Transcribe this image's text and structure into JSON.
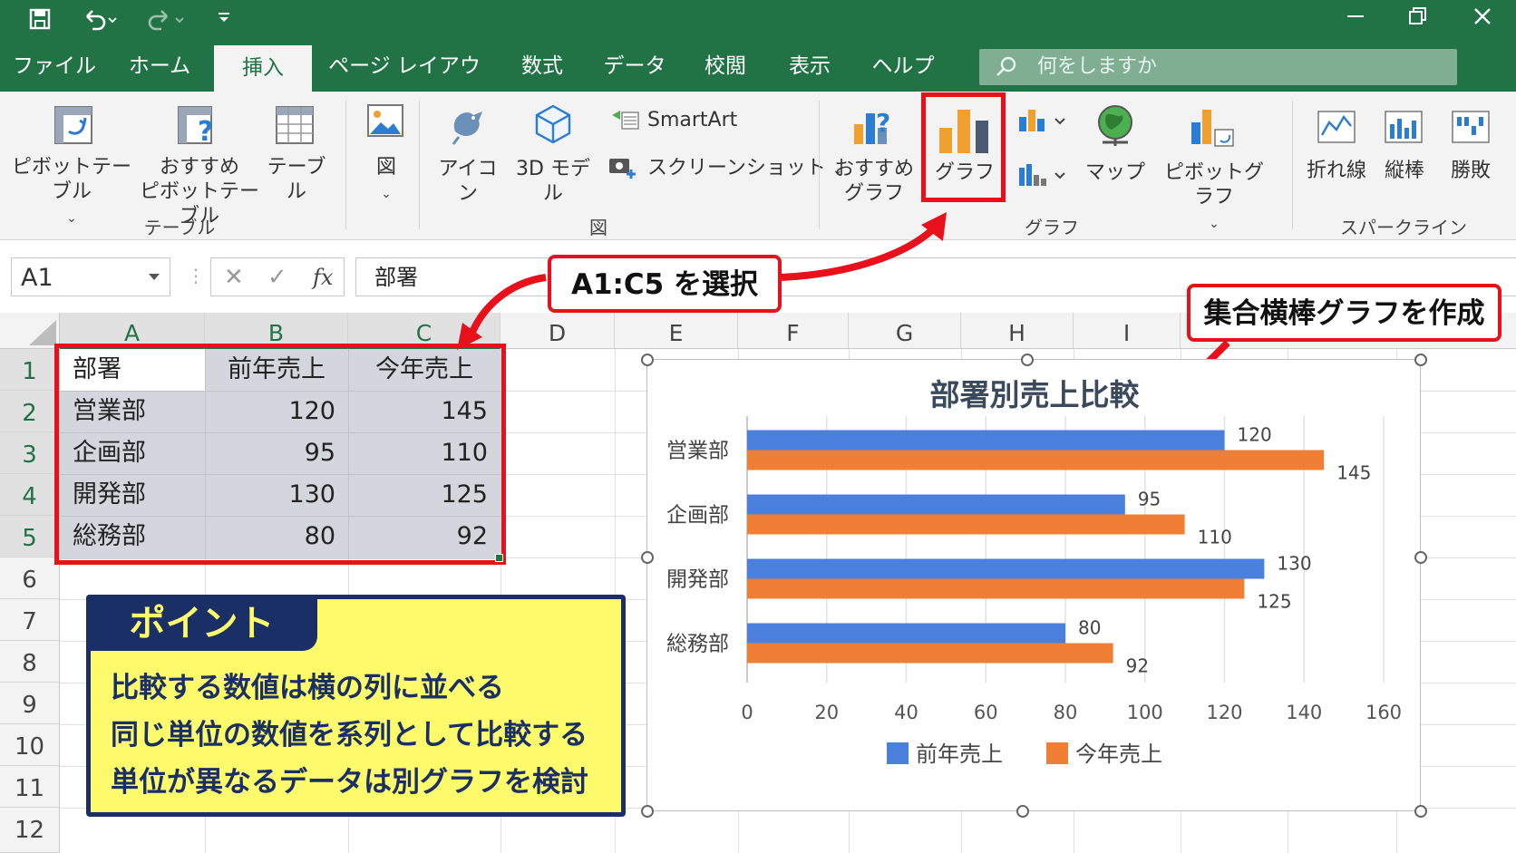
{
  "title_bar": {
    "qat": {
      "save_icon": "save-icon",
      "undo_icon": "undo-icon",
      "redo_icon": "redo-icon"
    }
  },
  "tabs": [
    {
      "label": "ファイル",
      "active": false
    },
    {
      "label": "ホーム",
      "active": false
    },
    {
      "label": "挿入",
      "active": true
    },
    {
      "label": "ページ レイアウト",
      "active": false
    },
    {
      "label": "数式",
      "active": false
    },
    {
      "label": "データ",
      "active": false
    },
    {
      "label": "校閲",
      "active": false
    },
    {
      "label": "表示",
      "active": false
    },
    {
      "label": "ヘルプ",
      "active": false
    }
  ],
  "search": {
    "placeholder": "何をしますか"
  },
  "ribbon": {
    "pivot_table": "ピボットテーブル",
    "recommended_pivot_1": "おすすめ",
    "recommended_pivot_2": "ピボットテーブル",
    "table": "テーブル",
    "group_table": "テーブル",
    "picture": "図",
    "icons": "アイコン",
    "model_3d": "3D モデル",
    "smartart": "SmartArt",
    "screenshot": "スクリーンショット",
    "group_illust": "図",
    "recommended_charts_1": "おすすめ",
    "recommended_charts_2": "グラフ",
    "charts_button": "グラフ",
    "maps": "マップ",
    "pivot_chart": "ピボットグラフ",
    "group_charts": "グラフ",
    "spark_line": "折れ線",
    "spark_column": "縦棒",
    "spark_winloss": "勝敗",
    "group_sparklines": "スパークライン"
  },
  "formula_bar": {
    "name_box": "A1",
    "cancel_glyph": "✕",
    "enter_glyph": "✓",
    "fx_label": "fx",
    "value": "部署"
  },
  "columns": [
    "A",
    "B",
    "C",
    "D",
    "E",
    "F",
    "G",
    "H",
    "I"
  ],
  "rows": [
    "1",
    "2",
    "3",
    "4",
    "5",
    "6",
    "7",
    "8",
    "9",
    "10",
    "11",
    "12"
  ],
  "sheet": {
    "header": [
      "部署",
      "前年売上",
      "今年売上"
    ],
    "rows": [
      [
        "営業部",
        "120",
        "145"
      ],
      [
        "企画部",
        "95",
        "110"
      ],
      [
        "開発部",
        "130",
        "125"
      ],
      [
        "総務部",
        "80",
        "92"
      ]
    ]
  },
  "callouts": {
    "select_range": "A1:C5 を選択",
    "create_chart": "集合横棒グラフを作成"
  },
  "point_box": {
    "title": "ポイント",
    "lines": [
      "比較する数値は横の列に並べる",
      "同じ単位の数値を系列として比較する",
      "単位が異なるデータは別グラフを検討"
    ]
  },
  "colors": {
    "excel_green": "#217346",
    "series_blue": "#4a7fdb",
    "series_orange": "#f07f35",
    "highlight_red": "#e8101b",
    "point_yellow": "#fdfb6b",
    "point_navy": "#1a2f66"
  },
  "chart_data": {
    "type": "bar",
    "orientation": "horizontal",
    "title": "部署別売上比較",
    "categories": [
      "営業部",
      "企画部",
      "開発部",
      "総務部"
    ],
    "series": [
      {
        "name": "前年売上",
        "values": [
          120,
          95,
          130,
          80
        ],
        "color": "#4a7fdb"
      },
      {
        "name": "今年売上",
        "values": [
          145,
          110,
          125,
          92
        ],
        "color": "#f07f35"
      }
    ],
    "xlim": [
      0,
      160
    ],
    "x_ticks": [
      "0",
      "20",
      "40",
      "60",
      "80",
      "100",
      "120",
      "140",
      "160"
    ],
    "grid": true,
    "legend_position": "bottom",
    "data_labels": true
  }
}
